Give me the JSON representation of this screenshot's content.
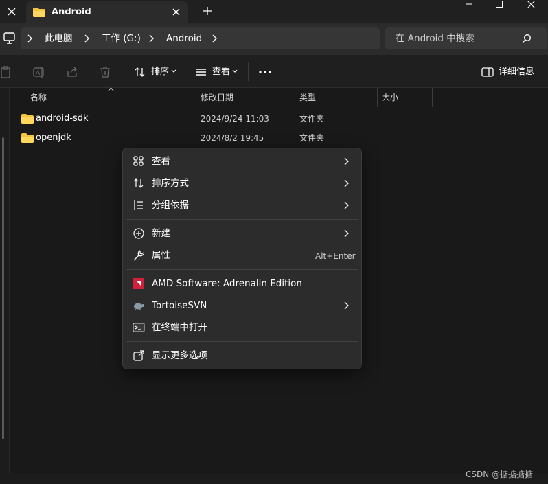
{
  "window": {
    "tab_title": "Android",
    "new_tab_symbol": "+"
  },
  "address": {
    "breadcrumbs": [
      "此电脑",
      "工作 (G:)",
      "Android"
    ],
    "search_placeholder": "在 Android 中搜索"
  },
  "toolbar": {
    "sort_label": "排序",
    "view_label": "查看",
    "details_label": "详细信息"
  },
  "columns": {
    "name": "名称",
    "modified": "修改日期",
    "type": "类型",
    "size": "大小"
  },
  "files": [
    {
      "name": "android-sdk",
      "modified": "2024/9/24 11:03",
      "type": "文件夹"
    },
    {
      "name": "openjdk",
      "modified": "2024/8/2 19:45",
      "type": "文件夹"
    }
  ],
  "context_menu": {
    "view": "查看",
    "sort_by": "排序方式",
    "group_by": "分组依据",
    "new": "新建",
    "properties": "属性",
    "properties_shortcut": "Alt+Enter",
    "amd": "AMD Software: Adrenalin Edition",
    "tortoise": "TortoiseSVN",
    "terminal": "在终端中打开",
    "more_options": "显示更多选项"
  },
  "watermark": "CSDN @掂掂掂掂",
  "colors": {
    "background": "#191919",
    "menu_background": "#2c2c2c",
    "folder_yellow": "#f4c443",
    "amd_red": "#d21f3c"
  }
}
